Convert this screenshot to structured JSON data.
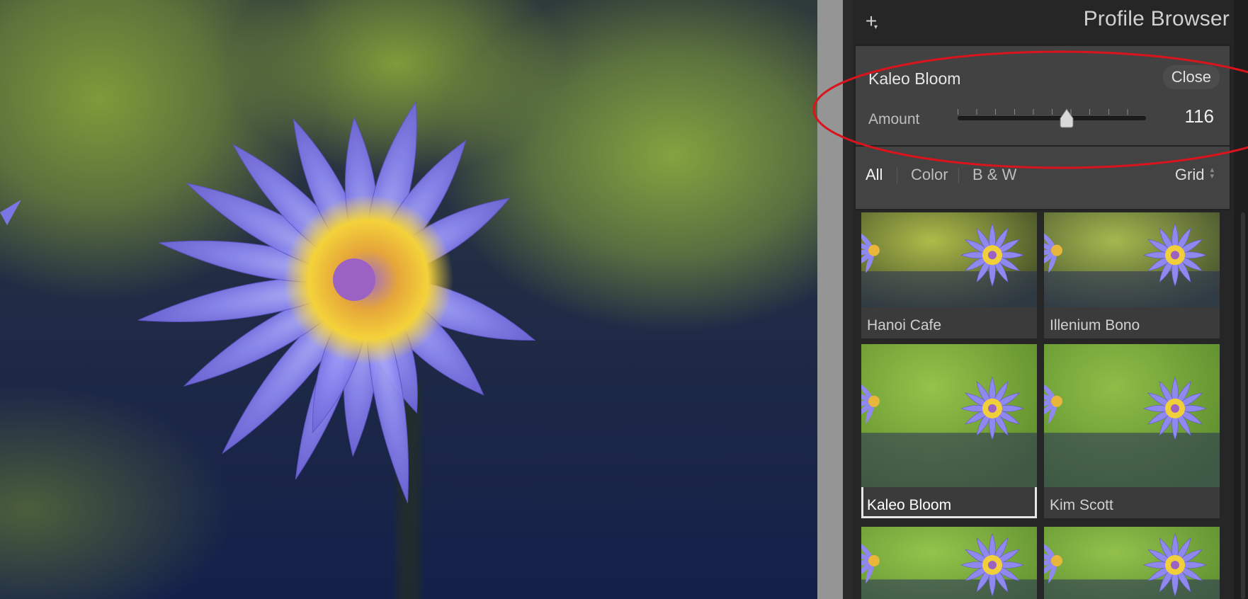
{
  "panel": {
    "title": "Profile Browser",
    "add_icon": "plus-icon",
    "selected_profile_name": "Kaleo Bloom",
    "close_label": "Close",
    "amount_label": "Amount",
    "amount_value": "116",
    "amount_fraction": 0.58,
    "filters": {
      "all": "All",
      "color": "Color",
      "bw": "B & W",
      "active": "All"
    },
    "view_mode": "Grid"
  },
  "profiles": [
    {
      "name": "Hanoi Cafe",
      "selected": false
    },
    {
      "name": "Illenium Bono",
      "selected": false
    },
    {
      "name": "Kaleo Bloom",
      "selected": true
    },
    {
      "name": "Kim Scott",
      "selected": false
    },
    {
      "name": "",
      "selected": false
    },
    {
      "name": "",
      "selected": false
    }
  ],
  "colors": {
    "annotation_red": "#d9141d",
    "panel_bg": "#262626",
    "selected_outline": "#e6e6e6"
  }
}
